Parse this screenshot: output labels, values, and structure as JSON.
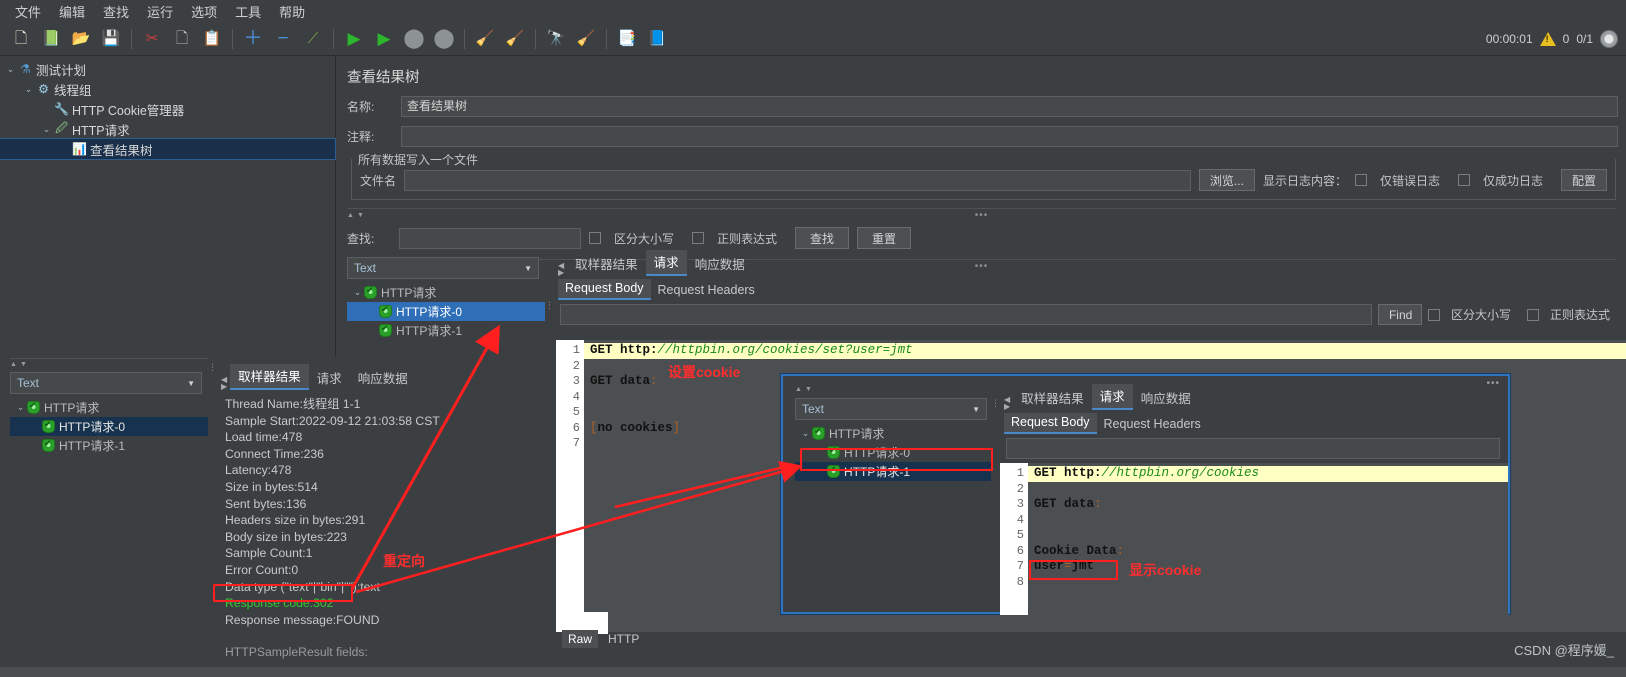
{
  "menubar": {
    "items": [
      "文件",
      "编辑",
      "查找",
      "运行",
      "选项",
      "工具",
      "帮助"
    ]
  },
  "toolbar": {
    "icons": [
      {
        "name": "new-icon",
        "glyph": "🗋"
      },
      {
        "name": "templates-icon",
        "glyph": "📚"
      },
      {
        "name": "open-icon",
        "glyph": "📂"
      },
      {
        "name": "save-icon",
        "glyph": "💾"
      },
      {
        "name": "cut-icon",
        "glyph": "✂"
      },
      {
        "name": "copy-icon",
        "glyph": "🗐"
      },
      {
        "name": "paste-icon",
        "glyph": "📋"
      },
      {
        "name": "expand-icon",
        "glyph": "＋"
      },
      {
        "name": "collapse-icon",
        "glyph": "−"
      },
      {
        "name": "toggle-icon",
        "glyph": "⚡"
      },
      {
        "name": "start-icon",
        "glyph": "▶"
      },
      {
        "name": "start-no-pause-icon",
        "glyph": "▷"
      },
      {
        "name": "stop-icon",
        "glyph": "⬤"
      },
      {
        "name": "shutdown-icon",
        "glyph": "⬤"
      },
      {
        "name": "clear-icon",
        "glyph": "🧹"
      },
      {
        "name": "clear-all-icon",
        "glyph": "🧹"
      },
      {
        "name": "search-icon",
        "glyph": "🔭"
      },
      {
        "name": "search-reset-icon",
        "glyph": "🖌"
      },
      {
        "name": "function-helper-icon",
        "glyph": "📑"
      },
      {
        "name": "help-icon",
        "glyph": "📘"
      }
    ],
    "elapsed_time": "00:00:01",
    "warning_count": "0",
    "thread_counter": "0/1"
  },
  "tree": {
    "nodes": [
      {
        "label": "测试计划",
        "icon": "test-plan-icon",
        "glyph": "⚗",
        "indent": 0,
        "twisty": "⌄",
        "selected": false
      },
      {
        "label": "线程组",
        "icon": "thread-group-icon",
        "glyph": "⚙",
        "indent": 1,
        "twisty": "⌄",
        "selected": false
      },
      {
        "label": "HTTP Cookie管理器",
        "icon": "cookie-manager-icon",
        "glyph": "🔧",
        "indent": 2,
        "twisty": "",
        "selected": false
      },
      {
        "label": "HTTP请求",
        "icon": "http-request-icon",
        "glyph": "🖊",
        "indent": 2,
        "twisty": "⌄",
        "selected": false
      },
      {
        "label": "查看结果树",
        "icon": "view-results-tree-icon",
        "glyph": "📈",
        "indent": 3,
        "twisty": "",
        "selected": true
      }
    ]
  },
  "main": {
    "title": "查看结果树",
    "name_label": "名称:",
    "name_value": "查看结果树",
    "comment_label": "注释:",
    "comment_value": "",
    "group_legend": "所有数据写入一个文件",
    "filename_label": "文件名",
    "filename_value": "",
    "browse_button": "浏览...",
    "log_display_label": "显示日志内容：",
    "errors_only_label": "仅错误日志",
    "success_only_label": "仅成功日志",
    "configure_button": "配置",
    "search_label": "查找:",
    "search_value": "",
    "case_sensitive_label": "区分大小写",
    "regex_label": "正则表达式",
    "find_button": "查找",
    "reset_button": "重置"
  },
  "results_panel": {
    "render_combo_value": "Text",
    "tree_nodes": [
      {
        "label": "HTTP请求",
        "indent": 0,
        "twisty": "⌄",
        "selected": false
      },
      {
        "label": "HTTP请求-0",
        "indent": 1,
        "twisty": "",
        "selected": true
      },
      {
        "label": "HTTP请求-1",
        "indent": 1,
        "twisty": "",
        "selected": false
      }
    ],
    "tabs": [
      {
        "label": "取样器结果",
        "active": false
      },
      {
        "label": "请求",
        "active": true
      },
      {
        "label": "响应数据",
        "active": false
      }
    ],
    "subtabs": [
      {
        "label": "Request Body",
        "active": true
      },
      {
        "label": "Request Headers",
        "active": false
      }
    ],
    "find_value": "",
    "find_button": "Find",
    "case_sensitive_label": "区分大小写",
    "regex_label": "正则表达式"
  },
  "editor_main": {
    "lines": [
      {
        "no": "1",
        "text": "GET http://httpbin.org/cookies/set?user=jmt",
        "highlight": true
      },
      {
        "no": "2",
        "text": "",
        "highlight": false
      },
      {
        "no": "3",
        "text": "GET data:",
        "highlight": false
      },
      {
        "no": "4",
        "text": "",
        "highlight": false
      },
      {
        "no": "5",
        "text": "",
        "highlight": false
      },
      {
        "no": "6",
        "text": "[no cookies]",
        "highlight": false
      },
      {
        "no": "7",
        "text": "",
        "highlight": false
      }
    ],
    "raw_tab": "Raw",
    "http_tab": "HTTP"
  },
  "bottom_left": {
    "render_combo_value": "Text",
    "tree_nodes": [
      {
        "label": "HTTP请求",
        "indent": 0,
        "twisty": "⌄",
        "selected": false
      },
      {
        "label": "HTTP请求-0",
        "indent": 1,
        "twisty": "",
        "selected": true
      },
      {
        "label": "HTTP请求-1",
        "indent": 1,
        "twisty": "",
        "selected": false
      }
    ],
    "tabs": [
      {
        "label": "取样器结果",
        "active": true
      },
      {
        "label": "请求",
        "active": false
      },
      {
        "label": "响应数据",
        "active": false
      }
    ],
    "sampler_lines": [
      "Thread Name:线程组 1-1",
      "Sample Start:2022-09-12 21:03:58 CST",
      "Load time:478",
      "Connect Time:236",
      "Latency:478",
      "Size in bytes:514",
      "Sent bytes:136",
      "Headers size in bytes:291",
      "Body size in bytes:223",
      "Sample Count:1",
      "Error Count:0",
      "Data type (\"text\"|\"bin\"|\"\"):text"
    ],
    "response_code_line": "Response code:302",
    "response_message_line": "Response message:FOUND",
    "trailing_line": "HTTPSampleResult fields:"
  },
  "float_window": {
    "render_combo_value": "Text",
    "tree_nodes": [
      {
        "label": "HTTP请求",
        "indent": 0,
        "twisty": "⌄",
        "selected": false
      },
      {
        "label": "HTTP请求-0",
        "indent": 1,
        "twisty": "",
        "selected": false
      },
      {
        "label": "HTTP请求-1",
        "indent": 1,
        "twisty": "",
        "selected": true
      }
    ],
    "tabs": [
      {
        "label": "取样器结果",
        "active": false
      },
      {
        "label": "请求",
        "active": true
      },
      {
        "label": "响应数据",
        "active": false
      }
    ],
    "subtabs": [
      {
        "label": "Request Body",
        "active": true
      },
      {
        "label": "Request Headers",
        "active": false
      }
    ],
    "editor_lines": [
      {
        "no": "1",
        "text": "GET http://httpbin.org/cookies",
        "highlight": true
      },
      {
        "no": "2",
        "text": "",
        "highlight": false
      },
      {
        "no": "3",
        "text": "GET data:",
        "highlight": false
      },
      {
        "no": "4",
        "text": "",
        "highlight": false
      },
      {
        "no": "5",
        "text": "",
        "highlight": false
      },
      {
        "no": "6",
        "text": "Cookie Data:",
        "highlight": false
      },
      {
        "no": "7",
        "text": "user=jmt",
        "highlight": false
      },
      {
        "no": "8",
        "text": "",
        "highlight": false
      }
    ]
  },
  "annotations": {
    "set_cookie": "设置cookie",
    "redirect": "重定向",
    "show_cookie": "显示cookie",
    "accent_red": "#ff1f1f",
    "accent_green": "#33cc33"
  },
  "watermark": "CSDN @程序媛_"
}
